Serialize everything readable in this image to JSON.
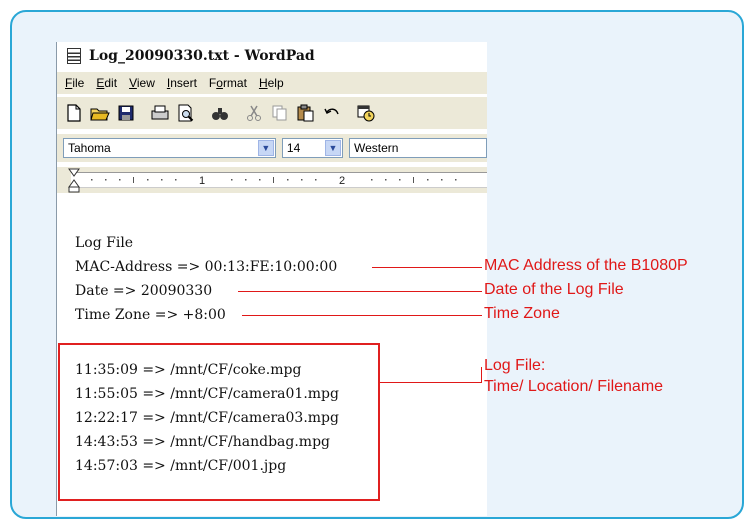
{
  "window": {
    "title": "Log_20090330.txt - WordPad",
    "menu": [
      {
        "label": "File",
        "mnemonic": "F",
        "rest": "ile"
      },
      {
        "label": "Edit",
        "mnemonic": "E",
        "rest": "dit"
      },
      {
        "label": "View",
        "mnemonic": "V",
        "rest": "iew"
      },
      {
        "label": "Insert",
        "mnemonic": "I",
        "rest": "nsert"
      },
      {
        "label": "Format",
        "mnemonic": "o",
        "pre": "F",
        "rest": "rmat"
      },
      {
        "label": "Help",
        "mnemonic": "H",
        "rest": "elp"
      }
    ],
    "font_name": "Tahoma",
    "font_size": "14",
    "script": "Western"
  },
  "toolbar_icons": [
    "new-document-icon",
    "open-folder-icon",
    "save-icon",
    "print-icon",
    "print-preview-icon",
    "find-icon",
    "cut-icon",
    "copy-icon",
    "paste-icon",
    "undo-icon",
    "date-time-icon"
  ],
  "document": {
    "header": "Log File",
    "mac": "MAC-Address => 00:13:FE:10:00:00",
    "date": "Date => 20090330",
    "timezone": "Time Zone => +8:00",
    "entries": [
      "11:35:09 => /mnt/CF/coke.mpg",
      "11:55:05 => /mnt/CF/camera01.mpg",
      "12:22:17 => /mnt/CF/camera03.mpg",
      "14:43:53 => /mnt/CF/handbag.mpg",
      "14:57:03 => /mnt/CF/001.jpg"
    ]
  },
  "annotations": {
    "mac": "MAC Address of the B1080P",
    "date": "Date of the Log File",
    "timezone": "Time Zone",
    "log_line1": "Log File:",
    "log_line2": "Time/ Location/ Filename"
  },
  "colors": {
    "accent": "#e01818",
    "frame": "#2aa7d6"
  }
}
